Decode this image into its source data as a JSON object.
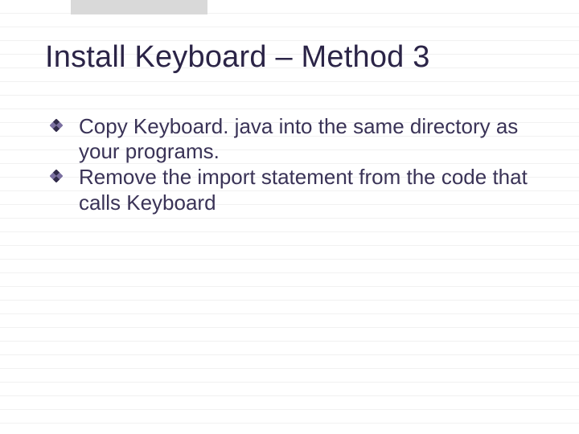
{
  "title": "Install Keyboard – Method 3",
  "bullets": [
    {
      "text": "Copy Keyboard. java into the same directory as your programs."
    },
    {
      "text": "Remove the import statement from the code that calls Keyboard"
    }
  ],
  "colors": {
    "heading": "#2b2447",
    "body": "#3a3357",
    "bulletDark": "#302a4a",
    "bulletLight": "#7a6fa0"
  }
}
